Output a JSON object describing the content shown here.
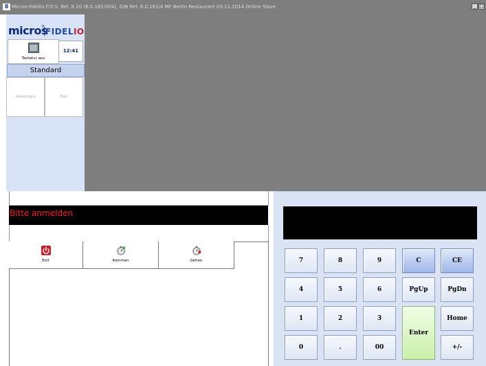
{
  "titlebar": {
    "icon": "8",
    "title": "Micros-Fidelio P.O.S. Rel. 8.10 (8.0.181/004), D/B Rel. 8.0.181/4 MF Berlin Restaurant 03.11.2014 Online Slave",
    "minimize": "_",
    "restore": "□",
    "close": "×"
  },
  "sidebar": {
    "logo": {
      "micros": "micros",
      "registered": "®",
      "fidelio_pre": "FIDEL",
      "fidelio_o": "IO"
    },
    "keyboard_label": "Tastatur aus",
    "clock": "12:41",
    "category": "Standard",
    "buttons": [
      "Anmelden",
      "Exit"
    ]
  },
  "message": "Bitte anmelden",
  "tabs": [
    {
      "label": "Exit",
      "icon": "power-icon"
    },
    {
      "label": "Kommen",
      "icon": "stopwatch-icon"
    },
    {
      "label": "Gehen",
      "icon": "stopwatch-stop-icon"
    }
  ],
  "keypad": {
    "rows": [
      [
        "7",
        "8",
        "9",
        "C",
        "CE"
      ],
      [
        "4",
        "5",
        "6",
        "PgUp",
        "PgDn"
      ],
      [
        "1",
        "2",
        "3",
        "Enter",
        "Home"
      ],
      [
        "0",
        ".",
        "00",
        "",
        "+/-"
      ]
    ]
  },
  "colors": {
    "workspace": "#7f7f7f",
    "sidebar": "#d8e3f7",
    "message_text": "#ff1a1a",
    "keypad_bg": "#d9e3f3",
    "key_blue": "#9fb6ea",
    "key_enter": "#c9f0ab"
  }
}
